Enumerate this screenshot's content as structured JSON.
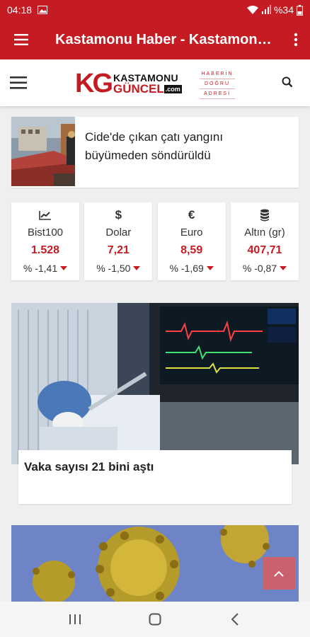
{
  "status_bar": {
    "time": "04:18",
    "battery": "%34"
  },
  "app_bar": {
    "title": "Kastamonu Haber - Kastamonu Güncel"
  },
  "site_header": {
    "logo_mark": "KG",
    "logo_line1": "KASTAMONU",
    "logo_line2": "GÜNCEL",
    "logo_com": ".com",
    "slogan": [
      "HABERİN",
      "DOĞRU",
      "ADRESİ"
    ]
  },
  "news_small": {
    "title": "Cide'de çıkan çatı yangını büyümeden söndürüldü"
  },
  "markets": [
    {
      "icon": "chart-line-icon",
      "name": "Bist100",
      "value": "1.528",
      "change": "% -1,41"
    },
    {
      "icon": "dollar-icon",
      "name": "Dolar",
      "value": "7,21",
      "change": "% -1,50"
    },
    {
      "icon": "euro-icon",
      "name": "Euro",
      "value": "8,59",
      "change": "% -1,69"
    },
    {
      "icon": "gold-stack-icon",
      "name": "Altın (gr)",
      "value": "407,71",
      "change": "% -0,87"
    }
  ],
  "news_big": {
    "title": "Vaka sayısı 21 bini aştı"
  },
  "colors": {
    "brand_red": "#c51b22",
    "down_red": "#c51b22"
  }
}
